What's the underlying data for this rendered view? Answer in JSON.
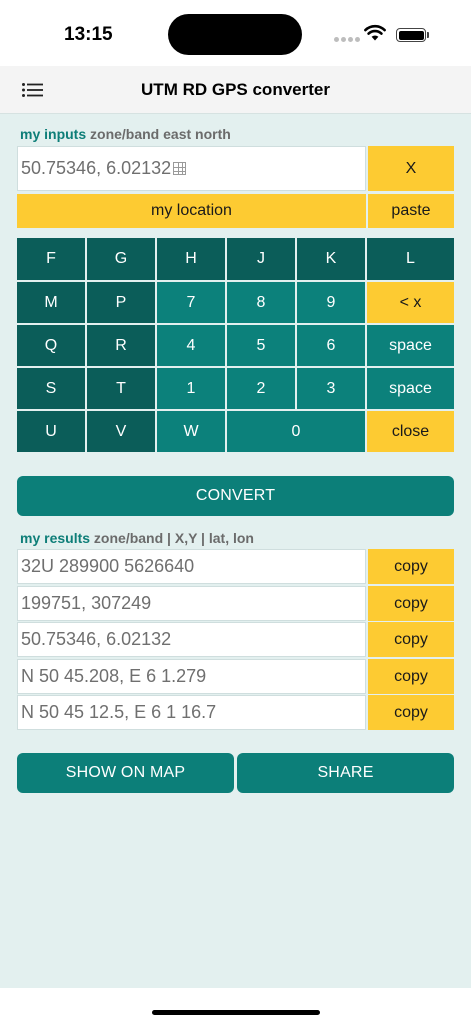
{
  "status": {
    "time": "13:15"
  },
  "nav": {
    "title": "UTM RD GPS converter",
    "menu_icon": "list-icon"
  },
  "inputs_label": {
    "accent": "my inputs",
    "rest": " zone/band east north"
  },
  "input": {
    "value": "50.75346, 6.02132",
    "clear_label": "X"
  },
  "actions": {
    "my_location": "my location",
    "paste": "paste"
  },
  "keypad": {
    "F": "F",
    "G": "G",
    "H": "H",
    "J": "J",
    "K": "K",
    "L": "L",
    "M": "M",
    "P": "P",
    "n7": "7",
    "n8": "8",
    "n9": "9",
    "backspace": "< x",
    "Q": "Q",
    "R": "R",
    "n4": "4",
    "n5": "5",
    "n6": "6",
    "space1": "space",
    "S": "S",
    "T": "T",
    "n1": "1",
    "n2": "2",
    "n3": "3",
    "space2": "space",
    "U": "U",
    "V": "V",
    "W": "W",
    "n0": "0",
    "close": "close"
  },
  "convert_label": "CONVERT",
  "results_label": {
    "accent": "my results",
    "rest": " zone/band | X,Y | lat, lon"
  },
  "results": [
    {
      "value": "32U 289900 5626640",
      "copy": "copy"
    },
    {
      "value": "199751, 307249",
      "copy": "copy"
    },
    {
      "value": "50.75346, 6.02132",
      "copy": "copy"
    },
    {
      "value": "N 50 45.208, E 6 1.279",
      "copy": "copy"
    },
    {
      "value": "N 50 45 12.5, E 6 1 16.7",
      "copy": "copy"
    }
  ],
  "bottom": {
    "show_on_map": "SHOW ON MAP",
    "share": "SHARE"
  },
  "colors": {
    "teal_dark": "#0b5d59",
    "teal": "#0c817b",
    "yellow": "#fdcb32",
    "background": "#e3f0ef"
  }
}
